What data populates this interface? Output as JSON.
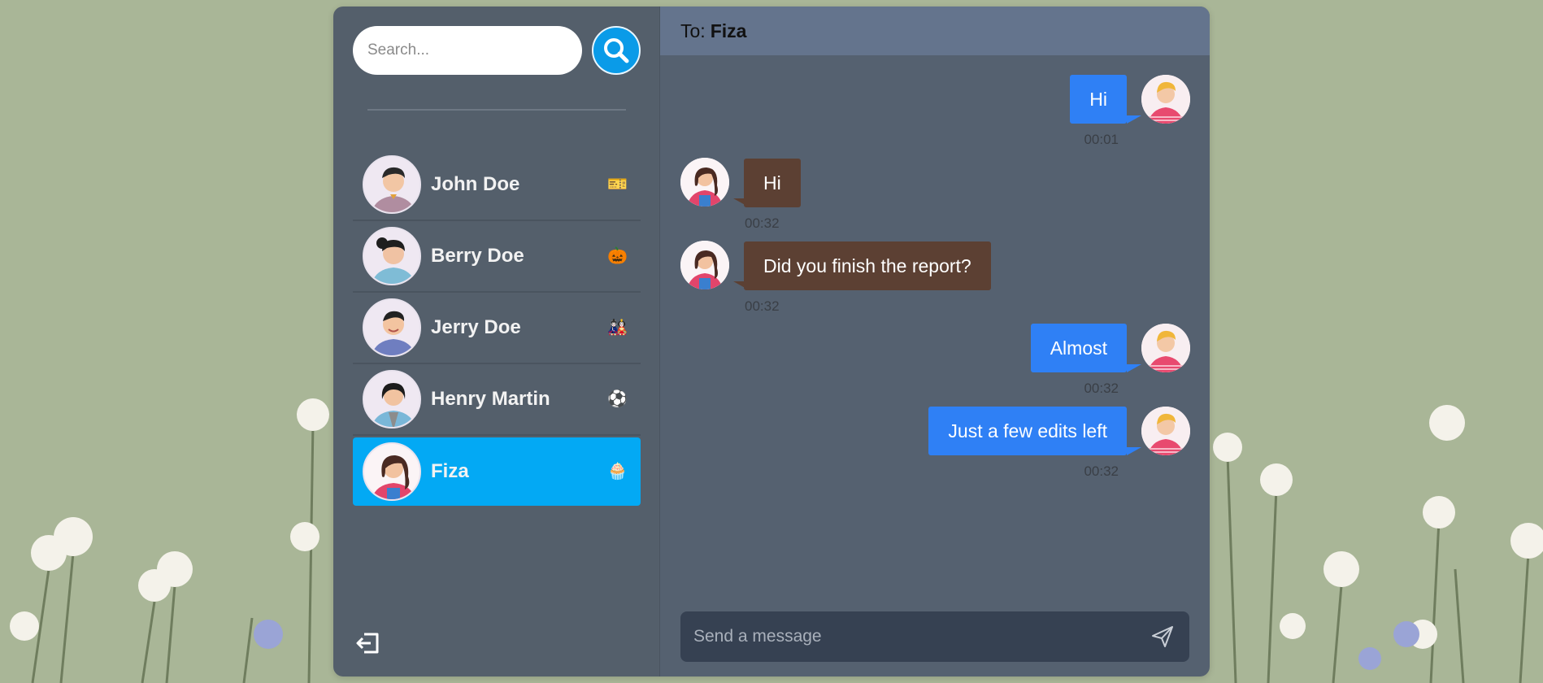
{
  "search": {
    "placeholder": "Search..."
  },
  "icons": {
    "search_button": "search-icon",
    "logout": "logout-icon",
    "send": "send-icon"
  },
  "colors": {
    "active_contact": "#03a9f4",
    "outgoing_bubble": "#2f80f5",
    "incoming_bubble": "#5c4033",
    "header": "#64748d"
  },
  "contacts": [
    {
      "name": "John Doe",
      "emoji": "🎫",
      "active": false
    },
    {
      "name": "Berry Doe",
      "emoji": "🎃",
      "active": false
    },
    {
      "name": "Jerry Doe",
      "emoji": "🎎",
      "active": false
    },
    {
      "name": "Henry Martin",
      "emoji": "⚽",
      "active": false
    },
    {
      "name": "Fiza",
      "emoji": "🧁",
      "active": true
    }
  ],
  "chat": {
    "to_label": "To:",
    "recipient": "Fiza",
    "messages": [
      {
        "text": "Hi",
        "time": "00:01",
        "direction": "out"
      },
      {
        "text": "Hi",
        "time": "00:32",
        "direction": "in"
      },
      {
        "text": "Did you finish the report?",
        "time": "00:32",
        "direction": "in"
      },
      {
        "text": "Almost",
        "time": "00:32",
        "direction": "out"
      },
      {
        "text": "Just a few edits left",
        "time": "00:32",
        "direction": "out"
      }
    ],
    "composer_placeholder": "Send a message"
  }
}
